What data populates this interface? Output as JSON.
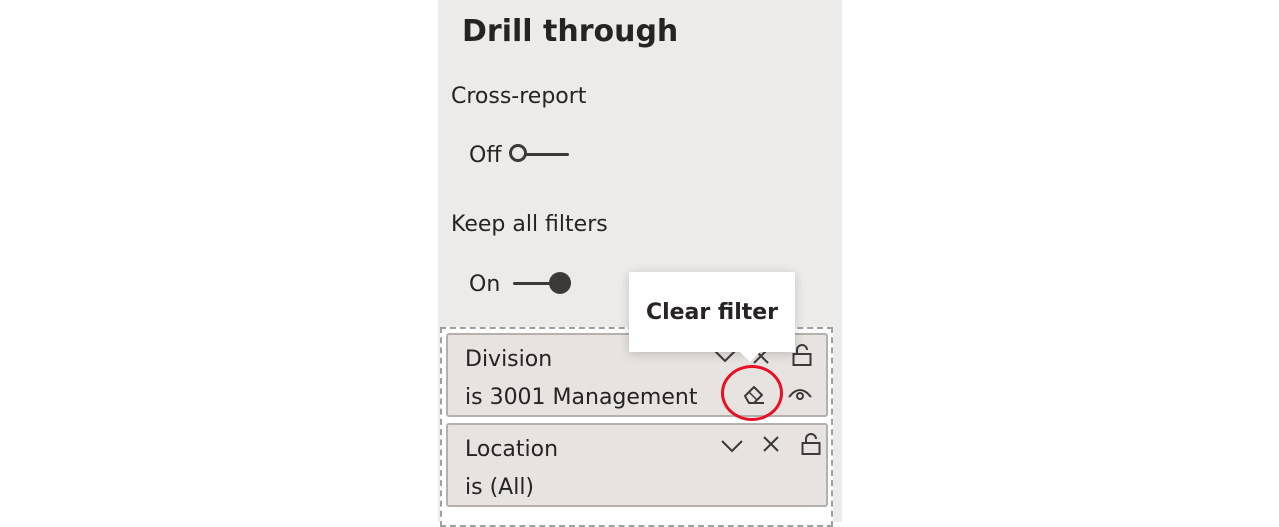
{
  "pane": {
    "title": "Drill through"
  },
  "cross_report": {
    "label": "Cross-report",
    "state_text": "Off",
    "state": false
  },
  "keep_all_filters": {
    "label": "Keep all filters",
    "state_text": "On",
    "state": true
  },
  "filters": [
    {
      "field": "Division",
      "value": "is 3001 Management",
      "icons": [
        "chevron-down-icon",
        "close-icon",
        "lock-icon",
        "eraser-icon",
        "eye-icon"
      ]
    },
    {
      "field": "Location",
      "value": "is (All)",
      "icons": [
        "chevron-down-icon",
        "close-icon",
        "lock-icon"
      ]
    }
  ],
  "tooltip": {
    "text": "Clear filter"
  },
  "colors": {
    "pane_background": "#edebe9",
    "card_background": "#e6e3e0",
    "highlight_ring": "#e81123",
    "toggle": "#3b3a39"
  }
}
